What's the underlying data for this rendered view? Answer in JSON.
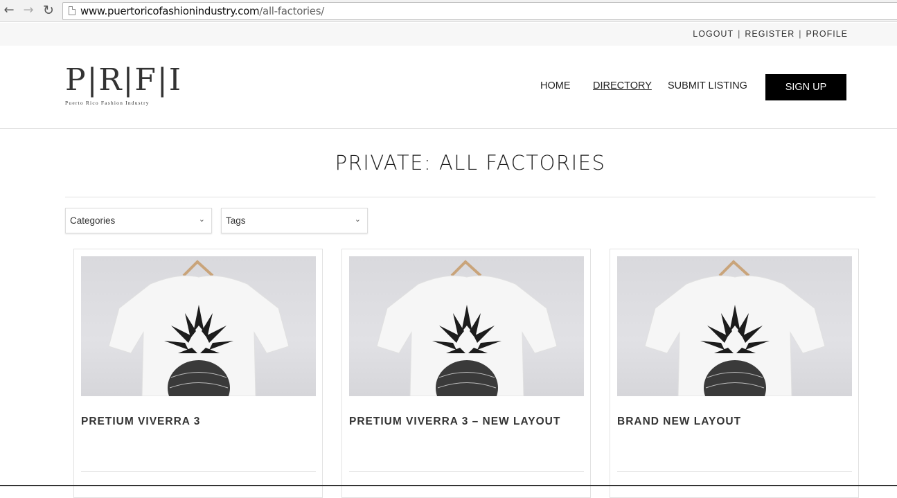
{
  "browser": {
    "url_host": "www.puertoricofashionindustry.com",
    "url_path": "/all-factories/"
  },
  "user_bar": {
    "logout": "LOGOUT",
    "register": "REGISTER",
    "profile": "PROFILE",
    "separator": "|"
  },
  "header": {
    "logo_letters": "P|R|F|I",
    "logo_subtitle": "Puerto Rico Fashion Industry",
    "nav": {
      "home": "HOME",
      "directory": "DIRECTORY",
      "submit": "SUBMIT LISTING"
    },
    "signup": "SIGN UP"
  },
  "page": {
    "title": "PRIVATE: ALL FACTORIES"
  },
  "filters": {
    "categories": "Categories",
    "tags": "Tags"
  },
  "listings": [
    {
      "title": "PRETIUM VIVERRA 3"
    },
    {
      "title": "PRETIUM VIVERRA 3 – NEW LAYOUT"
    },
    {
      "title": "BRAND NEW LAYOUT"
    }
  ],
  "colors": {
    "signup_bg": "#000000",
    "text": "#222222",
    "border": "#e2e2e2"
  }
}
